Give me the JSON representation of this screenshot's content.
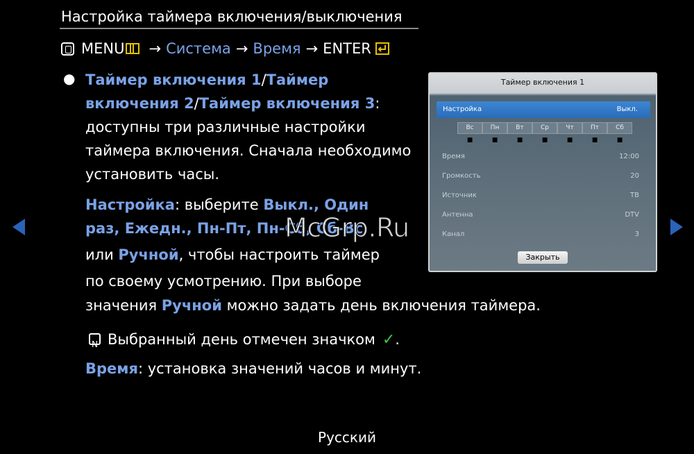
{
  "header": {
    "title": "Настройка таймера включения/выключения",
    "path_menu": "MENU",
    "path_arrow1": "→",
    "path_system": "Система",
    "path_arrow2": "→",
    "path_time": "Время",
    "path_arrow3": "→",
    "path_enter": "ENTER"
  },
  "content": {
    "bullet": "●",
    "l1_a": "Таймер включения 1",
    "l1_b": "/",
    "l1_c": "Таймер",
    "l2_a": "включения 2",
    "l2_b": "/",
    "l2_c": "Таймер включения 3",
    "l2_d": ":",
    "l3": "доступны три различные настройки",
    "l4": "таймера включения. Сначала необходимо",
    "l5": "установить часы.",
    "l6_a": "Настройка",
    "l6_b": ": выберите ",
    "l6_c": "Выкл., Один",
    "l7": "раз, Ежедн., Пн-Пт, Пн-Сб, Сб-Вс",
    "l8_a": "или ",
    "l8_b": "Ручной",
    "l8_c": ", чтобы настроить таймер",
    "l9": "по своему усмотрению. При выборе",
    "l10_a": "значения ",
    "l10_b": "Ручной",
    "l10_c": " можно задать день включения таймера.",
    "note": "Выбранный день отмечен значком",
    "note_end": ".",
    "l12_a": "Время",
    "l12_b": ": установка значений часов и минут."
  },
  "panel": {
    "title": "Таймер включения 1",
    "setting_label": "Настройка",
    "setting_value": "Выкл.",
    "days": [
      "Вс",
      "Пн",
      "Вт",
      "Ср",
      "Чт",
      "Пт",
      "Сб"
    ],
    "rows": [
      {
        "label": "Время",
        "value": "12:00"
      },
      {
        "label": "Громкость",
        "value": "20"
      },
      {
        "label": "Источник",
        "value": "ТВ"
      },
      {
        "label": "Антенна",
        "value": "DTV"
      },
      {
        "label": "Канал",
        "value": "3"
      }
    ],
    "close_label": "Закрыть"
  },
  "footer": {
    "language": "Русский"
  },
  "watermark": "McGrp.Ru",
  "colors": {
    "accent_text": "#7aa2e6",
    "nav_arrow": "#2a63b8",
    "check": "#41c441",
    "icon_yellow": "#e3c000"
  }
}
